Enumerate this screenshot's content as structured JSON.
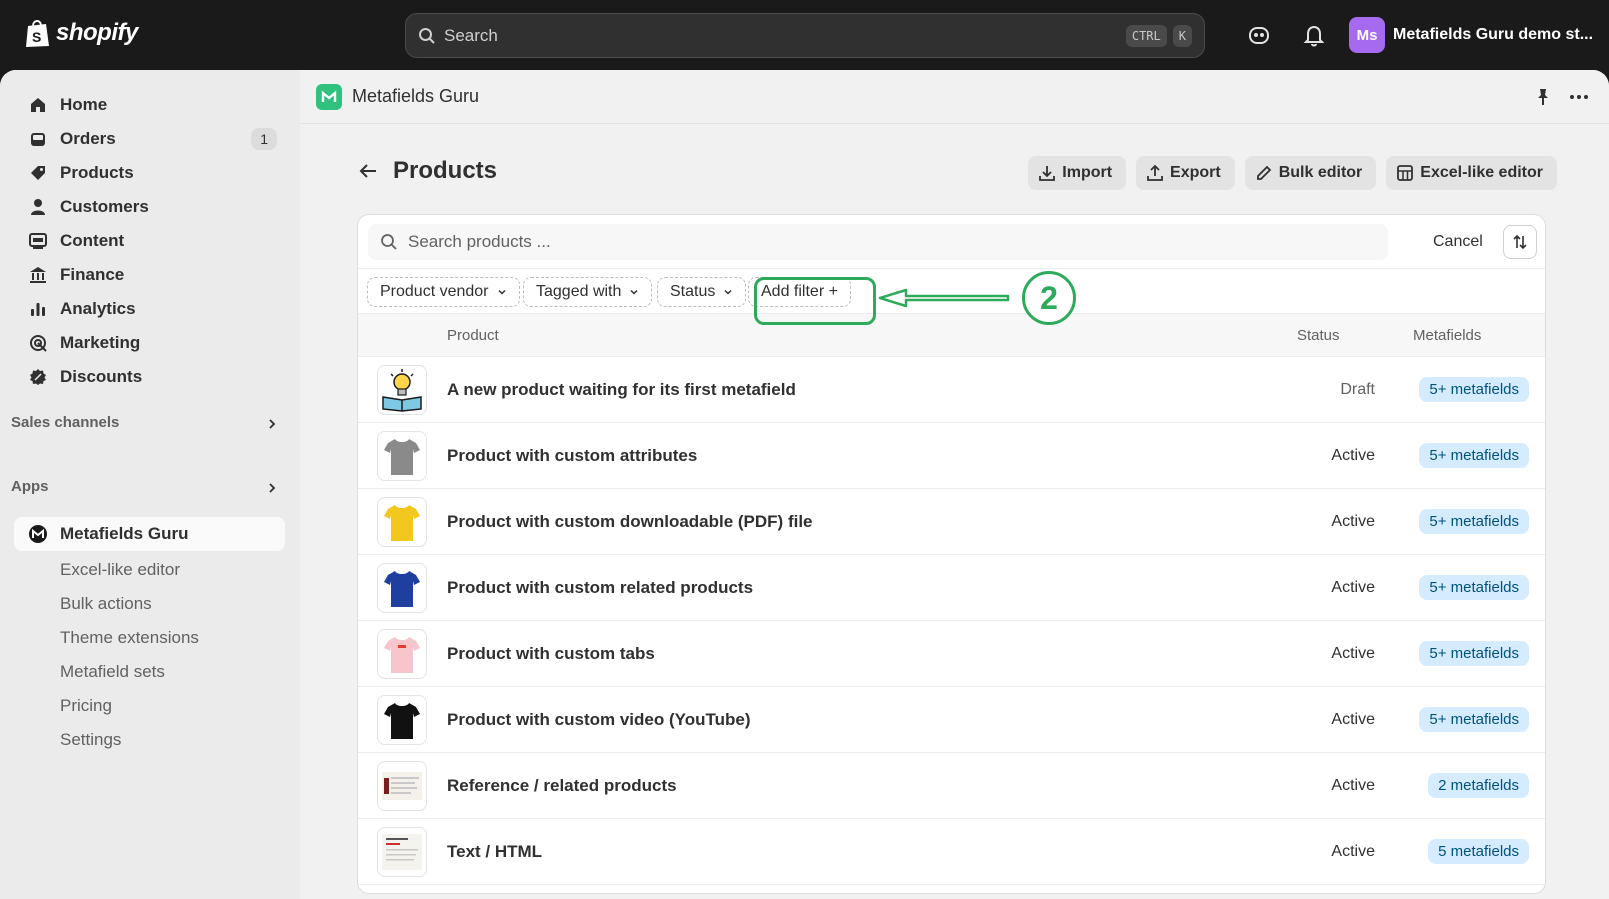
{
  "topbar": {
    "brand": "shopify",
    "search_placeholder": "Search",
    "kbd_1": "CTRL",
    "kbd_2": "K",
    "avatar_initials": "Ms",
    "store_name": "Metafields Guru demo st..."
  },
  "sidebar": {
    "items": [
      {
        "label": "Home",
        "icon": "home-icon"
      },
      {
        "label": "Orders",
        "icon": "orders-icon",
        "badge": "1"
      },
      {
        "label": "Products",
        "icon": "tag-icon"
      },
      {
        "label": "Customers",
        "icon": "person-icon"
      },
      {
        "label": "Content",
        "icon": "content-icon"
      },
      {
        "label": "Finance",
        "icon": "bank-icon"
      },
      {
        "label": "Analytics",
        "icon": "bar-chart-icon"
      },
      {
        "label": "Marketing",
        "icon": "target-icon"
      },
      {
        "label": "Discounts",
        "icon": "discount-icon"
      }
    ],
    "sales_channels": "Sales channels",
    "apps": "Apps",
    "app_active": "Metafields Guru",
    "app_subitems": [
      "Excel-like editor",
      "Bulk actions",
      "Theme extensions",
      "Metafield sets",
      "Pricing",
      "Settings"
    ]
  },
  "app_header": {
    "title": "Metafields Guru"
  },
  "page": {
    "title": "Products",
    "buttons": {
      "import": "Import",
      "export": "Export",
      "bulk": "Bulk editor",
      "excel": "Excel-like editor"
    }
  },
  "filters": {
    "search_placeholder": "Search products ...",
    "cancel": "Cancel",
    "chips": [
      "Product vendor",
      "Tagged with",
      "Status"
    ],
    "add_filter": "Add filter +",
    "annotation_number": "2"
  },
  "table": {
    "headers": {
      "product": "Product",
      "status": "Status",
      "metafields": "Metafields"
    },
    "rows": [
      {
        "title": "A new product waiting for its first metafield",
        "status": "Draft",
        "metafields": "5+ metafields",
        "thumb": "lightbulb-book"
      },
      {
        "title": "Product with custom attributes",
        "status": "Active",
        "metafields": "5+ metafields",
        "thumb": "tshirt",
        "color": "#8a8a8a"
      },
      {
        "title": "Product with custom downloadable (PDF) file",
        "status": "Active",
        "metafields": "5+ metafields",
        "thumb": "tshirt",
        "color": "#f2c81e"
      },
      {
        "title": "Product with custom related products",
        "status": "Active",
        "metafields": "5+ metafields",
        "thumb": "tshirt",
        "color": "#1f3fa0"
      },
      {
        "title": "Product with custom tabs",
        "status": "Active",
        "metafields": "5+ metafields",
        "thumb": "tshirt",
        "color": "#f7c5cc"
      },
      {
        "title": "Product with custom video (YouTube)",
        "status": "Active",
        "metafields": "5+ metafields",
        "thumb": "tshirt",
        "color": "#111111"
      },
      {
        "title": "Reference / related products",
        "status": "Active",
        "metafields": "2 metafields",
        "thumb": "doc"
      },
      {
        "title": "Text / HTML",
        "status": "Active",
        "metafields": "5 metafields",
        "thumb": "doc"
      }
    ]
  },
  "colors": {
    "annotation": "#2daa5a",
    "badge_bg": "#d5ebff",
    "avatar": "#a66af0"
  }
}
